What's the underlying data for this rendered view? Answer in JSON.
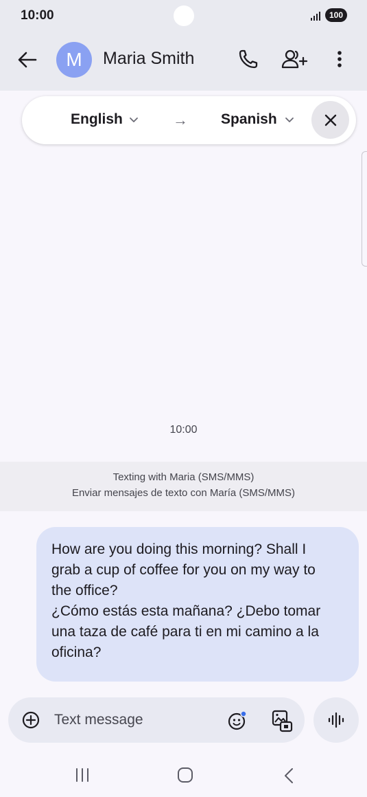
{
  "status": {
    "time": "10:00",
    "battery": "100",
    "icons": [
      "signal-icon",
      "battery-icon"
    ]
  },
  "header": {
    "avatar_letter": "M",
    "contact_name": "Maria Smith",
    "avatar_color": "#8aa1f2",
    "icons": [
      "back-arrow-icon",
      "phone-icon",
      "add-person-icon",
      "more-vert-icon"
    ]
  },
  "translate": {
    "source_lang": "English",
    "arrow": "→",
    "target_lang": "Spanish",
    "icons": [
      "chevron-down-icon",
      "close-icon"
    ]
  },
  "conversation": {
    "timestamp": "10:00",
    "info_line_1": "Texting with Maria (SMS/MMS)",
    "info_line_2": "Enviar mensajes de texto con María (SMS/MMS)",
    "message_lines": [
      "How are you doing this morning? Shall I",
      "grab a cup of coffee for you on my way to",
      "the office?",
      "¿Cómo estás esta mañana? ¿Debo tomar",
      "una taza de café para ti en mi camino a la",
      "oficina?"
    ],
    "bubble_color": "#dde3f8"
  },
  "composer": {
    "placeholder": "Text message",
    "icons": [
      "add-circle-icon",
      "emoji-icon",
      "gallery-icon",
      "voice-wave-icon"
    ]
  },
  "navbar": {
    "icons": [
      "recent-apps-icon",
      "home-icon",
      "nav-back-icon"
    ]
  }
}
